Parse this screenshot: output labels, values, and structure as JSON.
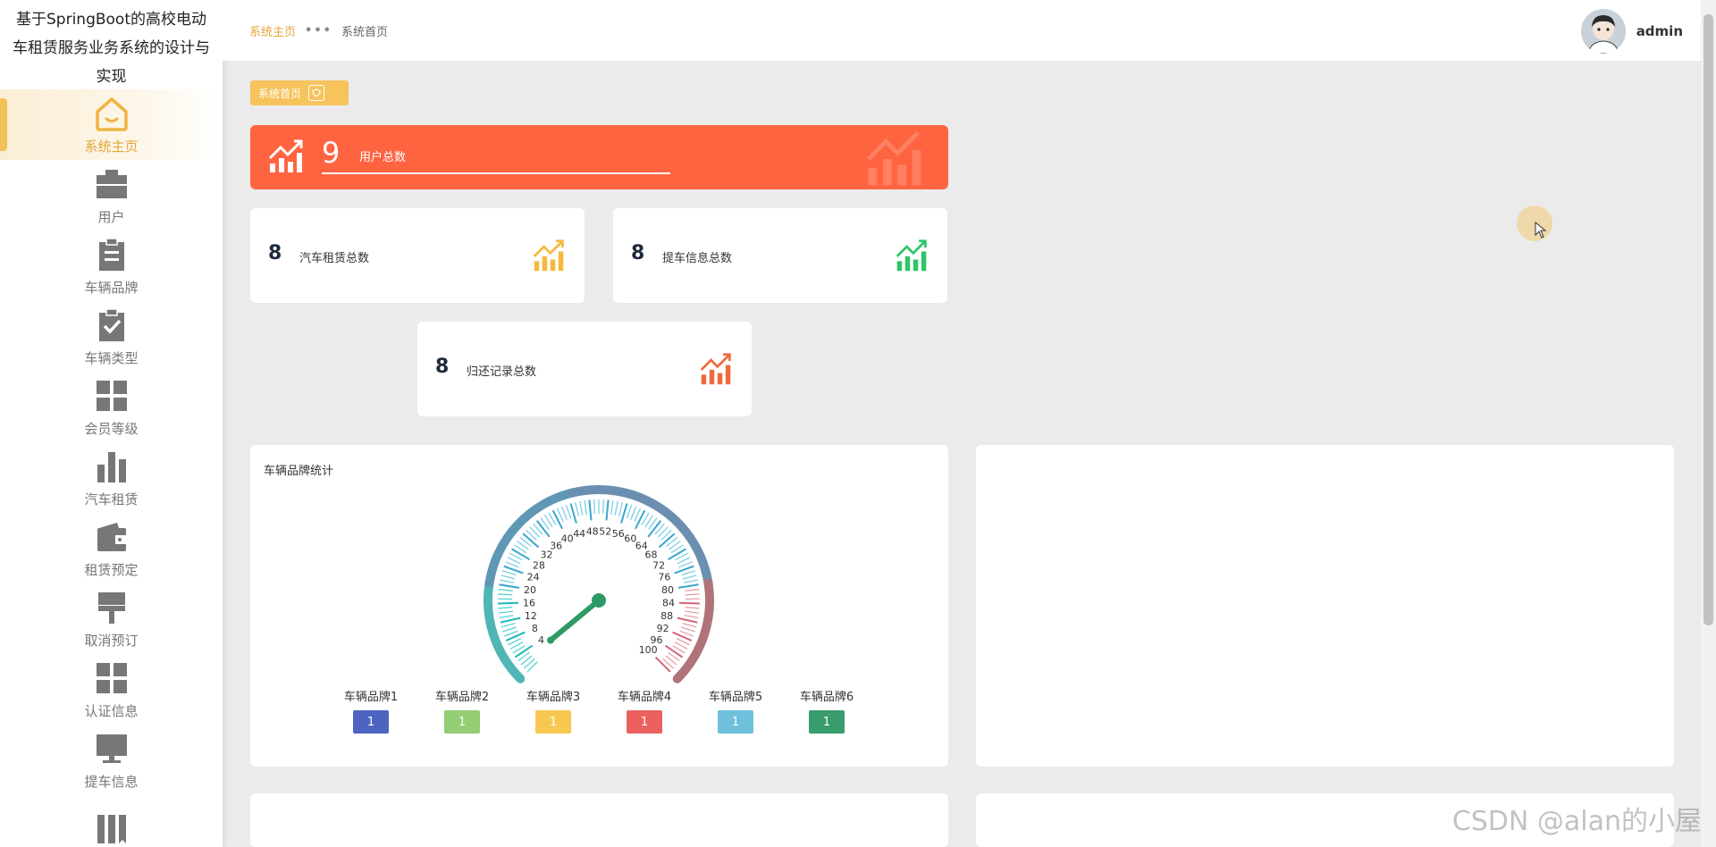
{
  "app": {
    "title": "基于SpringBoot的高校电动车租赁服务业务系统的设计与实现"
  },
  "sidebar": {
    "items": [
      {
        "label": "系统主页",
        "icon": "home-icon",
        "active": true
      },
      {
        "label": "用户",
        "icon": "briefcase-icon"
      },
      {
        "label": "车辆品牌",
        "icon": "clipboard-icon"
      },
      {
        "label": "车辆类型",
        "icon": "clipboard-check-icon"
      },
      {
        "label": "会员等级",
        "icon": "grid-icon"
      },
      {
        "label": "汽车租赁",
        "icon": "bar-chart-icon"
      },
      {
        "label": "租赁预定",
        "icon": "wallet-icon"
      },
      {
        "label": "取消预订",
        "icon": "brush-icon"
      },
      {
        "label": "认证信息",
        "icon": "grid-icon"
      },
      {
        "label": "提车信息",
        "icon": "monitor-icon"
      }
    ]
  },
  "header": {
    "breadcrumb": [
      "系统主页",
      "系统首页"
    ],
    "separator": "•••",
    "username": "admin"
  },
  "tag": {
    "label": "系统首页"
  },
  "stats": {
    "users": {
      "value": "9",
      "label": "用户总数"
    },
    "rentals": {
      "value": "8",
      "label": "汽车租赁总数"
    },
    "pickups": {
      "value": "8",
      "label": "提车信息总数"
    },
    "returns": {
      "value": "8",
      "label": "归还记录总数"
    }
  },
  "colors": {
    "accent": "#e7a63a",
    "red_card": "#ff6441",
    "icon_yellow": "#f6b93b",
    "icon_green": "#2ec467",
    "icon_orange": "#ee6a3c"
  },
  "chart_data": {
    "type": "gauge",
    "title": "车辆品牌统计",
    "min": 0,
    "max": 100,
    "tick_labels": [
      "4",
      "8",
      "12",
      "16",
      "20",
      "24",
      "28",
      "32",
      "36",
      "40",
      "44",
      "48",
      "52",
      "56",
      "60",
      "64",
      "68",
      "72",
      "76",
      "80",
      "84",
      "88",
      "92",
      "96",
      "100"
    ],
    "needle_value": 2,
    "categories": [
      "车辆品牌1",
      "车辆品牌2",
      "车辆品牌3",
      "车辆品牌4",
      "车辆品牌5",
      "车辆品牌6"
    ],
    "values": [
      1,
      1,
      1,
      1,
      1,
      1
    ],
    "colors": [
      "#4d64c0",
      "#93cd74",
      "#f7c851",
      "#ea6160",
      "#6ec0dc",
      "#399c6d"
    ]
  },
  "watermark": "CSDN @alan的小屋"
}
